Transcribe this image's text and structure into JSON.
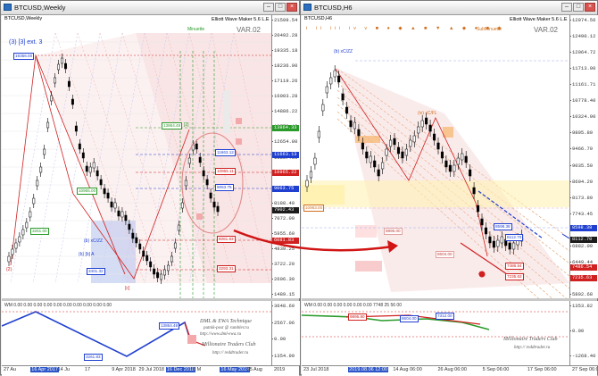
{
  "windows": {
    "left": {
      "title": "BTCUSD,Weekly",
      "symbol_label": "BTCUSD,Weekly",
      "indicator": "Elliott Wave Maker 5.6 L.E",
      "version": "VAR.02",
      "mode_label": "Minuette",
      "wave_labels": [
        "(3) [3] ext. 3",
        "(b) [b] A",
        "[c]",
        "[2]",
        "[5]",
        "(2)",
        "(b) xC/ZZ"
      ],
      "price_axis": [
        "21599.54",
        "20492.28",
        "19335.18",
        "18236.00",
        "17119.26",
        "16003.28",
        "14886.22",
        "13770.40",
        "12654.80",
        "11537.60",
        "10421.25",
        "9304.00",
        "8188.40",
        "7072.00",
        "5955.60",
        "4839.25",
        "3722.20",
        "2606.30",
        "1489.15"
      ],
      "sub_axis": [
        "3648.60",
        "2567.06",
        "0.00",
        "1354.99"
      ],
      "x_axis": [
        "27 Au",
        "16 Apr 2017",
        "14 Ju",
        "17",
        "9 Apr 2018",
        "29 Jul 2018",
        "16 Dec 2018",
        "5 M",
        "16 May 2019",
        "25 Aug",
        "2019"
      ],
      "x_highlight": [
        "16 Apr 2017",
        "16 Dec 2018",
        "16 May 2019"
      ],
      "price_tags": [
        "13864.33",
        "11663.13",
        "10965.22",
        "9063.75",
        "7902.43",
        "6081.83"
      ],
      "box_labels": [
        "19356.00",
        "13864.48",
        "11663.12",
        "10965.11",
        "9063.75",
        "6081.83",
        "4052.38",
        "3401.32",
        "3293.31",
        "10965.00",
        "3261.00"
      ],
      "sub_title": "WM 0.00 0.00 0.00 0.00 0.00 0.00 0.00 0.00 0.00 0.00",
      "sub_boxes": [
        "13864.48",
        "3261.83"
      ],
      "brand": [
        "DML & EWA Technique",
        "putnik-post @ rambler.ru",
        "http://www.dml-ewa.ru",
        "Millionaire Traders Club",
        "http:// reddtrader.ru"
      ]
    },
    "right": {
      "title": "BTCUSD,H6",
      "symbol_label": "BTCUSD,H6",
      "indicator": "Elliott Wave Maker 5.6 L.E",
      "version": "VAR.02",
      "mode_label": "SubMinuette",
      "top_row": "i ii iii iv v ■ ● ◆ ▲ ■ ▼ ▲ ◆ ● ■ ◆",
      "wave_labels": [
        "(b) xC/ZZ",
        "(iv) xC/FL",
        "(2)",
        "(3)",
        "4"
      ],
      "price_axis": [
        "12974.56",
        "12490.12",
        "12064.72",
        "11713.00",
        "11161.71",
        "10778.40",
        "10324.00",
        "9895.80",
        "9466.70",
        "9035.50",
        "8604.20",
        "8173.80",
        "7743.45",
        "7312.00",
        "6882.00",
        "6449.44",
        "6232.55",
        "5802.68"
      ],
      "sub_axis": [
        "1353.82",
        "0.00",
        "-1268.40"
      ],
      "x_axis": [
        "23 Jul 2018",
        "2019.08.06 12:00",
        "14 Aug 06:00",
        "26 Aug 06:00",
        "5 Sep 06:00",
        "17 Sep 06:00",
        "27 Sep 06:00"
      ],
      "x_highlight": [
        "2019.08.06 12:00"
      ],
      "price_tags": [
        "8598.38",
        "8112.70",
        "7486.54",
        "7235.63"
      ],
      "box_labels": [
        "10963.00",
        "9895.00",
        "8604.00",
        "7312.00"
      ],
      "sub_title": "WM 0.00 0.00 0.00 0.00 0.00 0.00 7748 25 56 00",
      "sub_boxes": [
        "9895.80",
        "8604.00",
        "7312.00"
      ],
      "brand": [
        "Millionaire Traders Club",
        "http:// reddtrader.ru"
      ]
    }
  },
  "colors": {
    "candle": "#000000",
    "wave_blue": "#1f3fd0",
    "wave_red": "#d02020",
    "fib_pink": "#f2c6c6",
    "fib_blue": "#b9c7ee",
    "zone_yellow": "#fff2b3",
    "zone_orange": "#f6b36a",
    "arrow": "#d11414"
  }
}
